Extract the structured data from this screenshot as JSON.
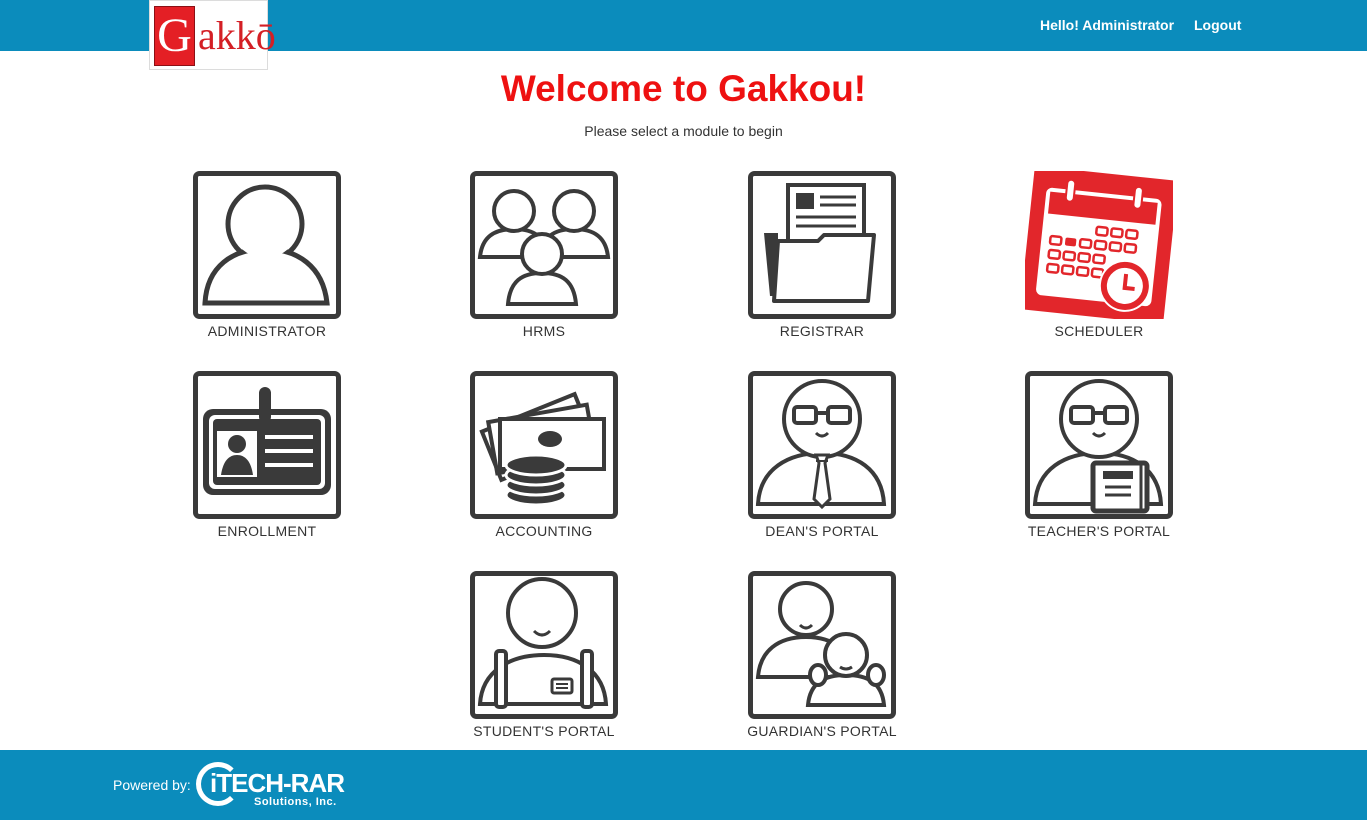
{
  "header": {
    "logo_initial": "G",
    "logo_rest": "akkō",
    "greeting": "Hello! Administrator",
    "logout_label": "Logout"
  },
  "main": {
    "title": "Welcome to Gakkou!",
    "subtitle": "Please select a module to begin"
  },
  "modules": [
    {
      "label": "ADMINISTRATOR",
      "icon": "administrator-icon"
    },
    {
      "label": "HRMS",
      "icon": "hrms-group-icon"
    },
    {
      "label": "REGISTRAR",
      "icon": "folder-documents-icon"
    },
    {
      "label": "SCHEDULER",
      "icon": "calendar-clock-icon"
    },
    {
      "label": "ENROLLMENT",
      "icon": "id-card-icon"
    },
    {
      "label": "ACCOUNTING",
      "icon": "money-coins-icon"
    },
    {
      "label": "DEAN'S PORTAL",
      "icon": "dean-tie-icon"
    },
    {
      "label": "TEACHER'S PORTAL",
      "icon": "teacher-book-icon"
    },
    {
      "label": "STUDENT'S PORTAL",
      "icon": "student-backpack-icon"
    },
    {
      "label": "GUARDIAN'S PORTAL",
      "icon": "guardian-child-icon"
    }
  ],
  "footer": {
    "powered_label": "Powered by:",
    "brand_name": "iTECH-RAR",
    "brand_sub": "Solutions, Inc."
  },
  "colors": {
    "bar": "#0b8cbc",
    "title": "#ee1111",
    "icon": "#3a3a3a",
    "scheduler": "#e2262b"
  }
}
